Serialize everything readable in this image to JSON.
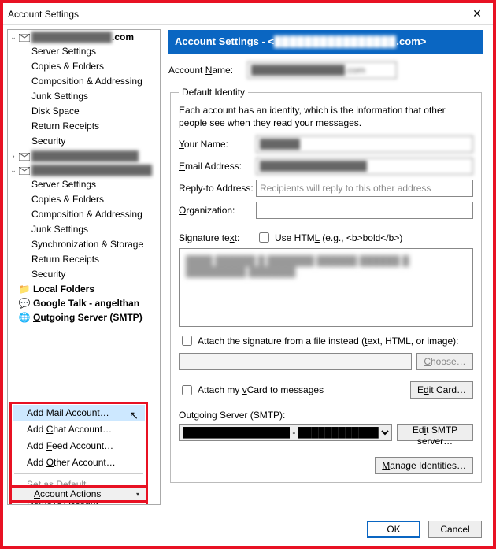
{
  "window": {
    "title": "Account Settings",
    "close_icon": "✕"
  },
  "sidebar": {
    "accounts": [
      {
        "expanded": true,
        "bold": true,
        "label_suffix": ".com",
        "children": [
          "Server Settings",
          "Copies & Folders",
          "Composition & Addressing",
          "Junk Settings",
          "Disk Space",
          "Return Receipts",
          "Security"
        ]
      },
      {
        "expanded": false,
        "bold": false,
        "label_suffix": "",
        "children": []
      },
      {
        "expanded": true,
        "bold": false,
        "label_suffix": "",
        "children": [
          "Server Settings",
          "Copies & Folders",
          "Composition & Addressing",
          "Junk Settings",
          "Synchronization & Storage",
          "Return Receipts",
          "Security"
        ]
      }
    ],
    "local_folders": "Local Folders",
    "google_talk": "Google Talk - angelthan",
    "outgoing_smtp": "Outgoing Server (SMTP)"
  },
  "context_menu": {
    "add_mail": "Add Mail Account…",
    "add_chat": "Add Chat Account…",
    "add_feed": "Add Feed Account…",
    "add_other": "Add Other Account…",
    "set_default": "Set as Default",
    "remove": "Remove Account"
  },
  "account_actions_button": "Account Actions",
  "panel": {
    "header_prefix": "Account Settings - <",
    "header_obscured": "████████████████",
    "header_suffix": ".com>",
    "account_name_label": "Account Name:",
    "account_name_value": "██████████████.com",
    "group_legend": "Default Identity",
    "hint": "Each account has an identity, which is the information that other people see when they read your messages.",
    "your_name_label": "Your Name:",
    "your_name_value": "██████",
    "email_label": "Email Address:",
    "email_value": "████████████████",
    "replyto_label": "Reply-to Address:",
    "replyto_placeholder": "Recipients will reply to this other address",
    "org_label": "Organization:",
    "org_value": "",
    "sig_label": "Signature text:",
    "use_html_label": "Use HTML (e.g., <b>bold</b>)",
    "sig_value": "████ ██████ █ ███████\n██████ ██████ █\n█████████ ███████",
    "attach_sig_label": "Attach the signature from a file instead (text, HTML, or image):",
    "choose_btn": "Choose…",
    "attach_vcard_label": "Attach my vCard to messages",
    "edit_card_btn": "Edit Card…",
    "smtp_label": "Outgoing Server (SMTP):",
    "smtp_value": "████████████████ - ████████████",
    "edit_smtp_btn": "Edit SMTP server…",
    "manage_btn": "Manage Identities…"
  },
  "footer": {
    "ok": "OK",
    "cancel": "Cancel"
  }
}
